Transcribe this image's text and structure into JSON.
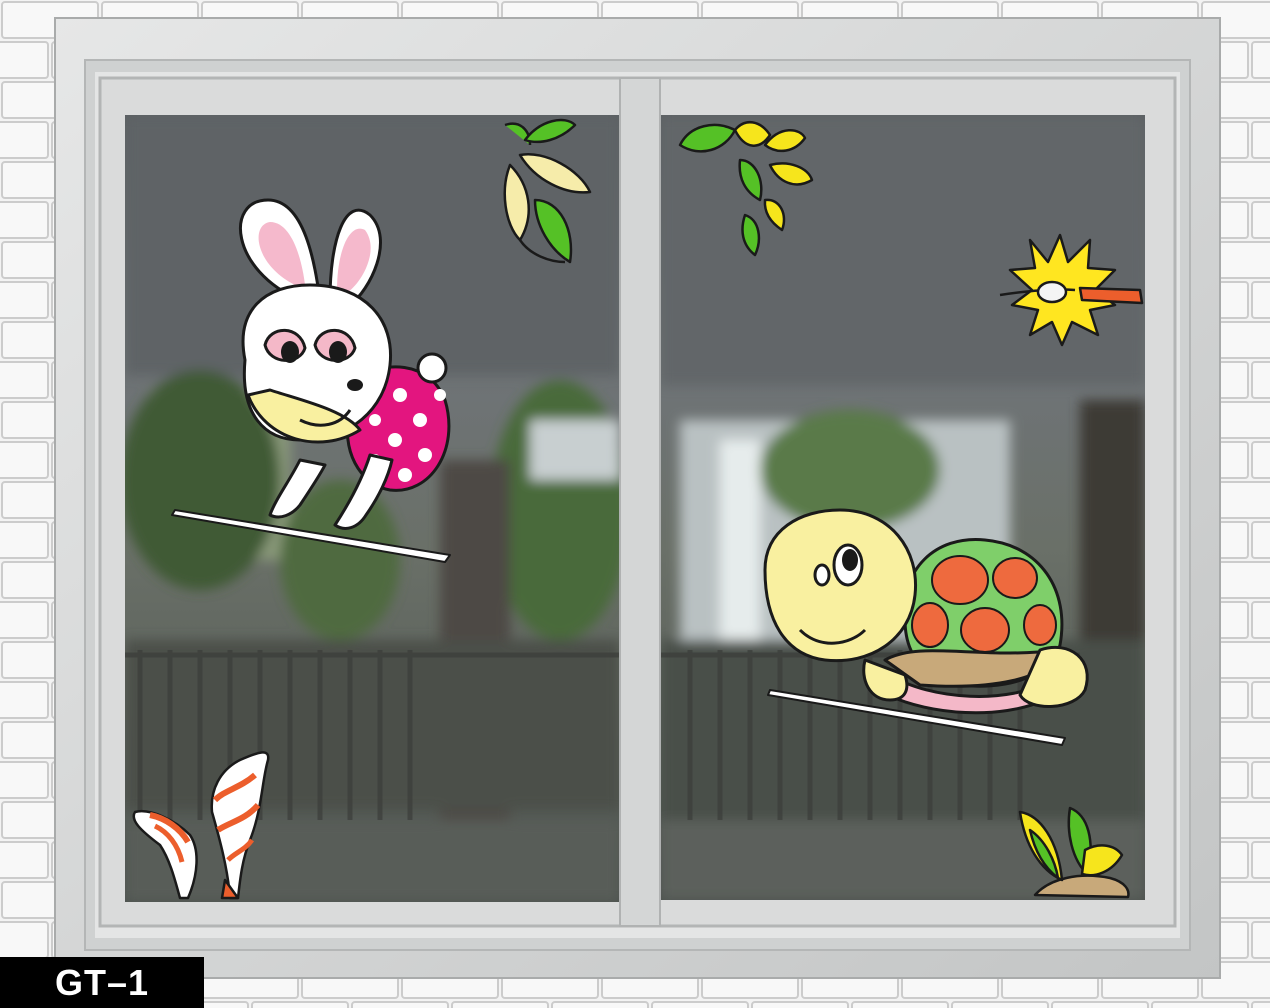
{
  "product_code": "GT–1",
  "colors": {
    "wall": "#f2f2f2",
    "mortar": "#c9c9c9",
    "frame": "#d7d8d8",
    "glass_sky": "#6d7275",
    "glass_ground": "#5a5f5b",
    "label_background": "#000000",
    "label_text": "#ffffff"
  },
  "stickers": [
    {
      "subject": "rabbit",
      "color": "#ffffff",
      "outfit_color": "#e0157f"
    },
    {
      "subject": "turtle",
      "color": "#f9f0a0",
      "shell_color": "#7fcf6a",
      "shell_spot_color": "#ee6a3e"
    },
    {
      "subject": "leaf-branch",
      "color": "#55c126"
    },
    {
      "subject": "starting-pistol-burst",
      "color": "#ffe620"
    },
    {
      "subject": "orange-plant",
      "color": "#ec5e2c"
    },
    {
      "subject": "yellow-green-plant",
      "color": "#f6e51c"
    }
  ]
}
